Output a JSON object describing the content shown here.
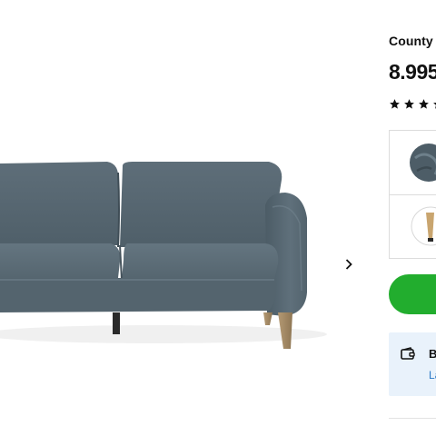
{
  "product": {
    "brand": "County",
    "price": "8.995",
    "rating_stars_visible": 4
  },
  "gallery": {
    "image_alt": "Grey-blue upholstered sofa with wooden legs",
    "next_icon": "chevron-right-icon"
  },
  "options": [
    {
      "icon": "fabric-swatch-icon"
    },
    {
      "icon": "wooden-leg-icon"
    }
  ],
  "buy_button": {
    "color": "#22ad2e",
    "label": ""
  },
  "payment": {
    "icon": "wallet-icon",
    "title": "B",
    "link": "La"
  },
  "colors": {
    "accent_green": "#22ad2e",
    "info_bg": "#e9f2fb",
    "link_blue": "#2b78c5",
    "sofa_fabric": "#5b6b75"
  }
}
